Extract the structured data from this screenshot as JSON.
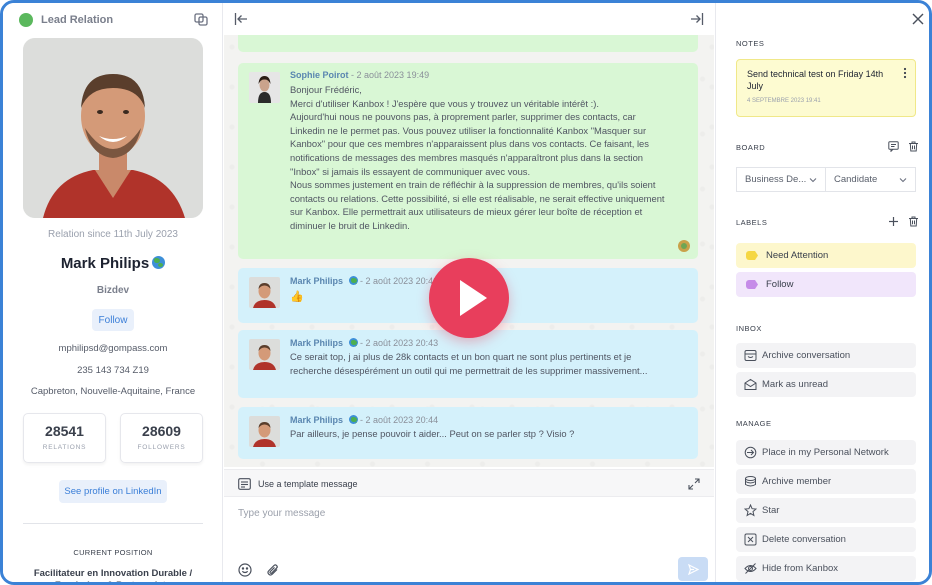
{
  "app": {
    "title": "Lead Relation"
  },
  "profile": {
    "since": "Relation since 11th July 2023",
    "name": "Mark Philips",
    "role": "Bizdev",
    "follow_label": "Follow",
    "email": "mphilipsd@gompass.com",
    "phone": "235 143 734 Z19",
    "location": "Capbreton, Nouvelle-Aquitaine, France",
    "relations_count": "28541",
    "relations_label": "RELATIONS",
    "followers_count": "28609",
    "followers_label": "FOLLOWERS",
    "linkedin_label": "See profile on LinkedIn",
    "current_position_label": "CURRENT POSITION",
    "current_position": "Facilitateur en Innovation Durable / Fundraiser & Partenariats"
  },
  "chat": {
    "messages": [
      {
        "author": "Sophie Poirot",
        "date": "- 2 août 2023 19:49",
        "lines": [
          "Bonjour Frédéric,",
          "Merci d'utiliser Kanbox ! J'espère que vous y trouvez un véritable intérêt :).",
          "Aujourd'hui nous ne pouvons pas, à proprement parler, supprimer des contacts, car",
          "Linkedin ne le permet pas. Vous pouvez utiliser la fonctionnalité Kanbox \"Masquer sur",
          "Kanbox\" pour que ces membres n'apparaissent plus dans vos contacts. Ce faisant, les",
          "notifications de messages des membres masqués n'apparaîtront plus dans la section",
          "\"Inbox\" si jamais ils essayent de communiquer avec vous.",
          "Nous sommes justement en train de réfléchir à la suppression de membres, qu'ils soient",
          "contacts ou relations. Cette possibilité, si elle est réalisable, ne serait effective uniquement",
          "sur Kanbox. Elle permettrait aux utilisateurs de mieux gérer leur boîte de réception et",
          "diminuer le bruit de Linkedin."
        ]
      },
      {
        "author": "Mark Philips",
        "date": "- 2 août 2023 20:40",
        "text": "👍"
      },
      {
        "author": "Mark Philips",
        "date": "- 2 août 2023 20:43",
        "lines": [
          "Ce serait top, j ai plus de 28k contacts et un bon quart ne sont plus pertinents et je",
          "recherche désespérément un outil qui me permettrait de les supprimer massivement..."
        ]
      },
      {
        "author": "Mark Philips",
        "date": "- 2 août 2023 20:44",
        "text": "Par ailleurs, je pense pouvoir t aider... Peut on se parler stp ? Visio ?"
      }
    ],
    "template_label": "Use a template message",
    "input_placeholder": "Type your message"
  },
  "panel": {
    "notes_label": "NOTES",
    "note_text": "Send technical test on Friday 14th July",
    "note_date": "4 SEPTEMBRE 2023 19:41",
    "board_label": "BOARD",
    "board_select": "Business De...",
    "stage_select": "Candidate",
    "labels_label": "LABELS",
    "labels": [
      {
        "name": "Need Attention",
        "bg": "#fdf7cc",
        "color": "#f5d742"
      },
      {
        "name": "Follow",
        "bg": "#f1e6fb",
        "color": "#c58be8"
      }
    ],
    "inbox_label": "INBOX",
    "inbox_actions": [
      "Archive conversation",
      "Mark as unread"
    ],
    "manage_label": "MANAGE",
    "manage_actions": [
      "Place in my Personal Network",
      "Archive member",
      "Star",
      "Delete conversation",
      "Hide from Kanbox"
    ]
  },
  "colors": {
    "accent": "#3b7fd8",
    "frame": "#3b82d6",
    "play": "#e83e5c",
    "status_dot": "#5bb85d"
  },
  "icons": [
    "sync-icon",
    "collapse-left-icon",
    "expand-right-icon",
    "close-icon",
    "play-icon",
    "template-icon",
    "expand-icon",
    "emoji-icon",
    "attach-icon",
    "send-icon",
    "comment-icon",
    "trash-icon",
    "plus-icon",
    "chevron-down-icon",
    "archive-icon",
    "envelope-icon",
    "network-icon",
    "star-icon",
    "delete-icon",
    "hide-icon",
    "more-icon"
  ]
}
